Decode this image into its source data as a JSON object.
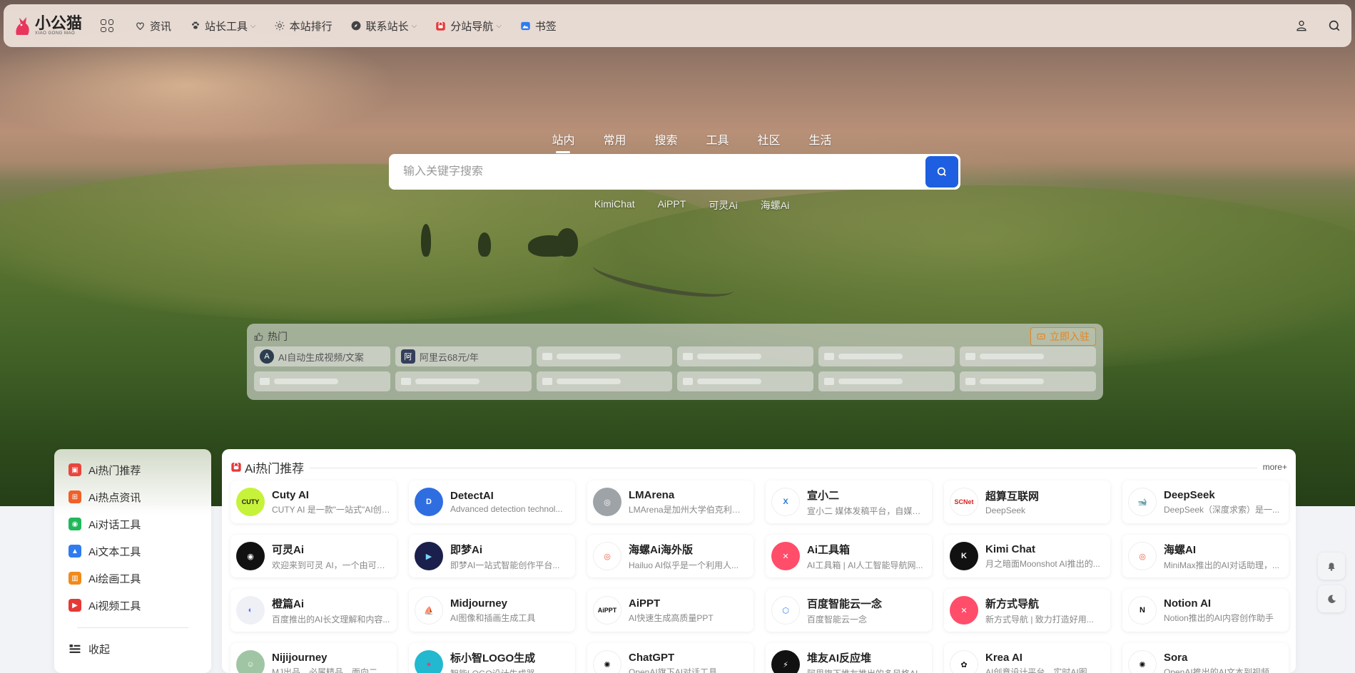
{
  "nav": {
    "logo_text": "小公猫",
    "logo_sub": "XIAO GONG MAO",
    "items": [
      {
        "label": "资讯",
        "icon": "heart-icon",
        "dropdown": false
      },
      {
        "label": "站长工具",
        "icon": "paw-icon",
        "dropdown": true
      },
      {
        "label": "本站排行",
        "icon": "sun-icon",
        "dropdown": false
      },
      {
        "label": "联系站长",
        "icon": "compass-icon",
        "dropdown": true
      },
      {
        "label": "分站导航",
        "icon": "bag-icon",
        "dropdown": true
      },
      {
        "label": "书签",
        "icon": "image-icon",
        "dropdown": false
      }
    ]
  },
  "search": {
    "tabs": [
      "站内",
      "常用",
      "搜索",
      "工具",
      "社区",
      "生活"
    ],
    "active_tab": "站内",
    "placeholder": "输入关键字搜索",
    "value": "",
    "quick_links": [
      "KimiChat",
      "AiPPT",
      "可灵Ai",
      "海螺Ai"
    ]
  },
  "hot": {
    "title": "热门",
    "join_label": "立即入驻",
    "items": [
      {
        "label": "AI自动生成视频/文案",
        "avatar": "A"
      },
      {
        "label": "阿里云68元/年",
        "avatar": "阿"
      }
    ]
  },
  "sidebar": {
    "items": [
      {
        "label": "Ai热门推荐",
        "color": "#e8453c"
      },
      {
        "label": "Ai热点资讯",
        "color": "#f0602a"
      },
      {
        "label": "Ai对话工具",
        "color": "#1fb85a"
      },
      {
        "label": "Ai文本工具",
        "color": "#2f7bf0"
      },
      {
        "label": "Ai绘画工具",
        "color": "#f08a1c"
      },
      {
        "label": "Ai视频工具",
        "color": "#e53935"
      }
    ],
    "collapse_label": "收起"
  },
  "main": {
    "title": "Ai热门推荐",
    "more_label": "more+",
    "cards": [
      {
        "name": "Cuty AI",
        "desc": "CUTY AI 是一款\"一站式\"AI创作...",
        "logo_text": "CUTY",
        "logo_bg": "#c6f23a",
        "logo_color": "#1a1a1a"
      },
      {
        "name": "DetectAI",
        "desc": "Advanced detection technol...",
        "logo_text": "D",
        "logo_bg": "#2f6ee0",
        "logo_color": "#ffffff"
      },
      {
        "name": "LMArena",
        "desc": "LMArena是加州大学伯克利分校...",
        "logo_text": "◎",
        "logo_bg": "#9ea3a8",
        "logo_color": "#ffffff"
      },
      {
        "name": "宣小二",
        "desc": "宣小二 媒体发稿平台，自媒体...",
        "logo_text": "X",
        "logo_bg": "#ffffff",
        "logo_color": "#2a7bd6"
      },
      {
        "name": "超算互联网",
        "desc": "DeepSeek",
        "logo_text": "SCNet",
        "logo_bg": "#ffffff",
        "logo_color": "#d81e1e"
      },
      {
        "name": "DeepSeek",
        "desc": "DeepSeek（深度求索）是一...",
        "logo_text": "🐋",
        "logo_bg": "#ffffff",
        "logo_color": "#4d6bfe"
      },
      {
        "name": "可灵Ai",
        "desc": "欢迎来到可灵 AI，一个由可灵...",
        "logo_text": "◉",
        "logo_bg": "#111111",
        "logo_color": "#ffffff"
      },
      {
        "name": "即梦Ai",
        "desc": "即梦AI一站式智能创作平台...",
        "logo_text": "▶",
        "logo_bg": "#1b1f4b",
        "logo_color": "#7dd3fc"
      },
      {
        "name": "海螺Ai海外版",
        "desc": "Hailuo AI似乎是一个利用人...",
        "logo_text": "◎",
        "logo_bg": "#ffffff",
        "logo_color": "#f05a3c"
      },
      {
        "name": "Ai工具箱",
        "desc": "AI工具箱 | AI人工智能导航网...",
        "logo_text": "✕",
        "logo_bg": "#ff4d6a",
        "logo_color": "#ffffff"
      },
      {
        "name": "Kimi Chat",
        "desc": "月之暗面Moonshot AI推出的...",
        "logo_text": "K",
        "logo_bg": "#111111",
        "logo_color": "#ffffff"
      },
      {
        "name": "海螺AI",
        "desc": "MiniMax推出的AI对话助理，...",
        "logo_text": "◎",
        "logo_bg": "#ffffff",
        "logo_color": "#f05a3c"
      },
      {
        "name": "橙篇Ai",
        "desc": "百度推出的AI长文理解和内容...",
        "logo_text": "◐",
        "logo_bg": "#eef0f6",
        "logo_color": "#5b6cff"
      },
      {
        "name": "Midjourney",
        "desc": "AI图像和插画生成工具",
        "logo_text": "⛵",
        "logo_bg": "#ffffff",
        "logo_color": "#111111"
      },
      {
        "name": "AiPPT",
        "desc": "AI快速生成高质量PPT",
        "logo_text": "AiPPT",
        "logo_bg": "#ffffff",
        "logo_color": "#111111"
      },
      {
        "name": "百度智能云一念",
        "desc": "百度智能云一念",
        "logo_text": "⬡",
        "logo_bg": "#ffffff",
        "logo_color": "#2f7bf0"
      },
      {
        "name": "新方式导航",
        "desc": "新方式导航 | 致力打造好用...",
        "logo_text": "✕",
        "logo_bg": "#ff4d6a",
        "logo_color": "#ffffff"
      },
      {
        "name": "Notion AI",
        "desc": "Notion推出的AI内容创作助手",
        "logo_text": "N",
        "logo_bg": "#ffffff",
        "logo_color": "#111111"
      },
      {
        "name": "Nijijourney",
        "desc": "MJ出品，必属精品，面向二...",
        "logo_text": "☺",
        "logo_bg": "#9fc5a5",
        "logo_color": "#ffffff"
      },
      {
        "name": "标小智LOGO生成",
        "desc": "智能LOGO设计生成器",
        "logo_text": "●",
        "logo_bg": "#22b8cf",
        "logo_color": "#e0457b"
      },
      {
        "name": "ChatGPT",
        "desc": "OpenAI旗下AI对话工具",
        "logo_text": "✺",
        "logo_bg": "#ffffff",
        "logo_color": "#111111"
      },
      {
        "name": "堆友AI反应堆",
        "desc": "阿里旗下堆友推出的多风格AI...",
        "logo_text": "⚡",
        "logo_bg": "#111111",
        "logo_color": "#ffffff"
      },
      {
        "name": "Krea AI",
        "desc": "AI创意设计平台，实时AI图...",
        "logo_text": "✿",
        "logo_bg": "#ffffff",
        "logo_color": "#111111"
      },
      {
        "name": "Sora",
        "desc": "OpenAI推出的AI文本到视频...",
        "logo_text": "✺",
        "logo_bg": "#ffffff",
        "logo_color": "#111111"
      }
    ]
  }
}
